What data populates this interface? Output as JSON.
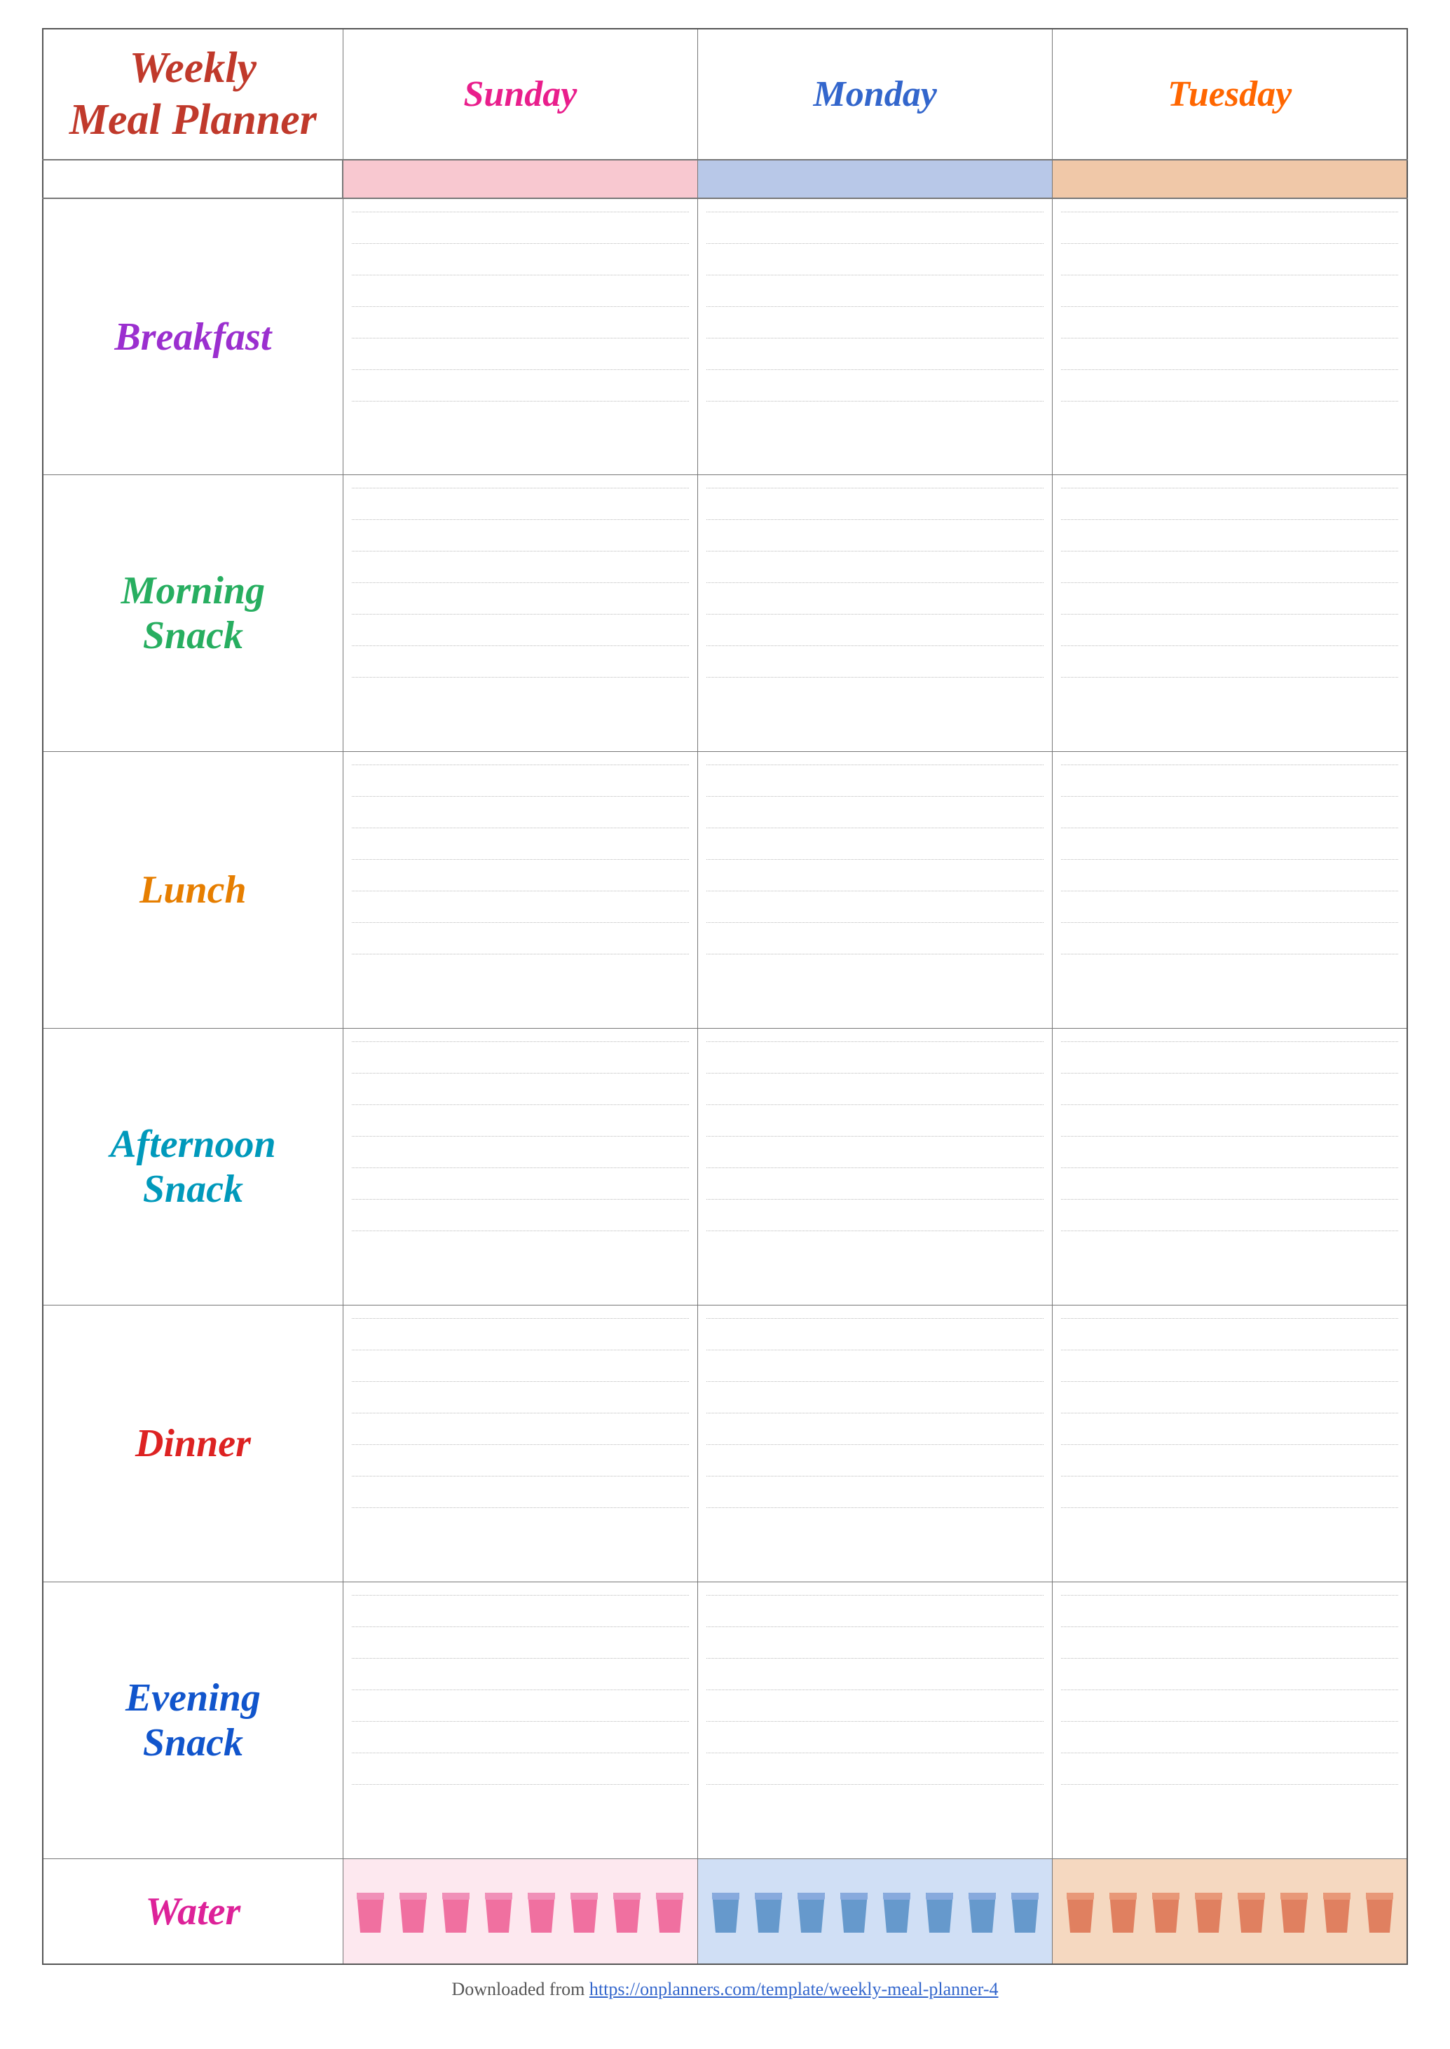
{
  "title": {
    "line1": "Weekly",
    "line2": "Meal Planner"
  },
  "days": {
    "sunday": "Sunday",
    "monday": "Monday",
    "tuesday": "Tuesday"
  },
  "meals": [
    {
      "id": "breakfast",
      "label": "Breakfast",
      "color_class": "label-breakfast"
    },
    {
      "id": "morning-snack",
      "label": "Morning Snack",
      "color_class": "label-morning-snack"
    },
    {
      "id": "lunch",
      "label": "Lunch",
      "color_class": "label-lunch"
    },
    {
      "id": "afternoon-snack",
      "label": "Afternoon Snack",
      "color_class": "label-afternoon-snack"
    },
    {
      "id": "dinner",
      "label": "Dinner",
      "color_class": "label-dinner"
    },
    {
      "id": "evening-snack",
      "label": "Evening Snack",
      "color_class": "label-evening-snack"
    }
  ],
  "water": {
    "label": "Water",
    "cups_count": 8
  },
  "footer": {
    "text": "Downloaded from ",
    "link_text": "https://onplanners.com/template/weekly-meal-planner-4",
    "link_href": "https://onplanners.com/template/weekly-meal-planner-4"
  }
}
